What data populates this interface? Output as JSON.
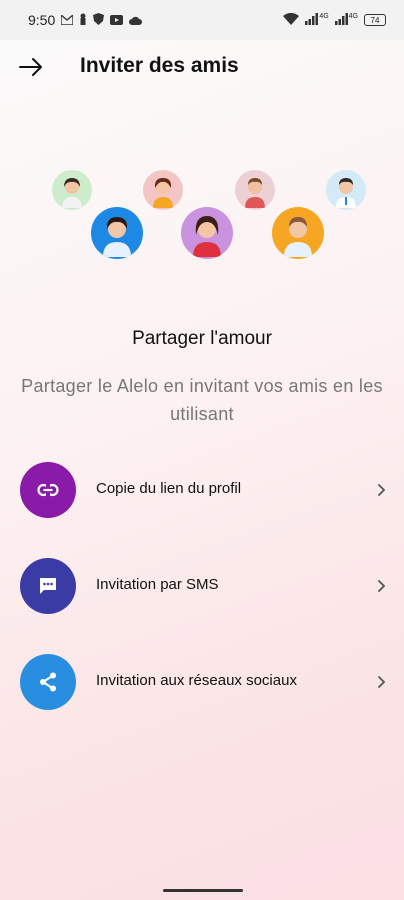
{
  "status_bar": {
    "time": "9:50",
    "battery": "74",
    "signal_label_1": "4G",
    "signal_label_2": "4G"
  },
  "header": {
    "title": "Inviter des amis",
    "back_icon": "arrow-right-icon"
  },
  "hero": {
    "subtitle": "Partager l'amour",
    "description": "Partager le Alelo en invitant vos amis en les utilisant"
  },
  "options": [
    {
      "label": "Copie du lien du profil",
      "icon": "link-icon",
      "color": "#8a1aa8"
    },
    {
      "label": "Invitation par SMS",
      "icon": "sms-icon",
      "color": "#3b3ba6"
    },
    {
      "label": "Invitation aux réseaux sociaux",
      "icon": "share-icon",
      "color": "#2a8ee0"
    }
  ],
  "colors": {
    "avatar_bg_green": "#cdeccc",
    "avatar_bg_pink": "#f3c5c5",
    "avatar_bg_rose": "#ecd0d4",
    "avatar_bg_lightblue": "#d5eaf7",
    "avatar_bg_blue": "#1e88e5",
    "avatar_bg_purple": "#c993e0",
    "avatar_bg_orange": "#f6a623"
  }
}
